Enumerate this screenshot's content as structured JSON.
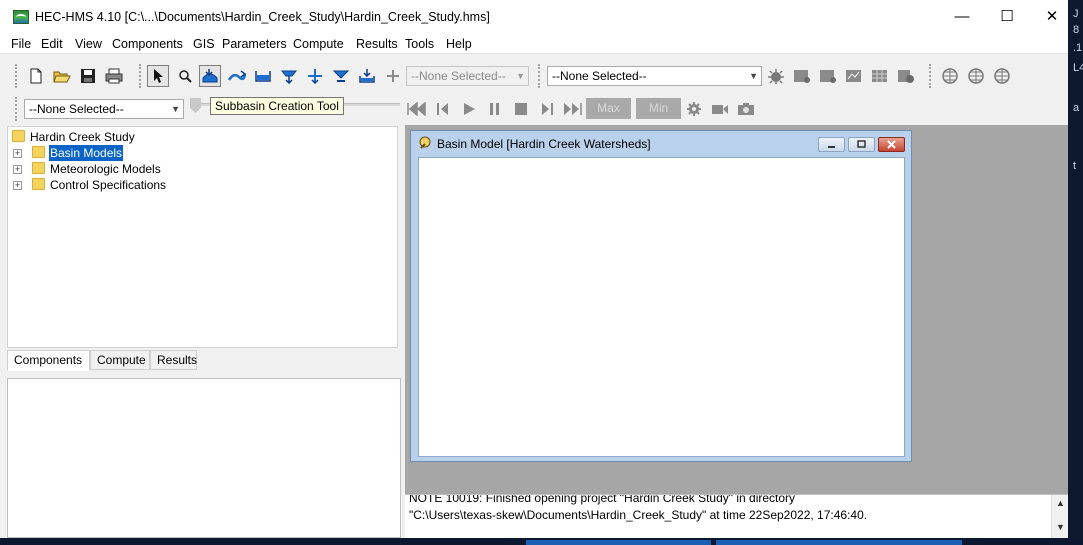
{
  "window": {
    "title": "HEC-HMS 4.10 [C:\\...\\Documents\\Hardin_Creek_Study\\Hardin_Creek_Study.hms]",
    "controls": {
      "minimize": "—",
      "maximize": "☐",
      "close": "✕"
    }
  },
  "menu": [
    "File",
    "Edit",
    "View",
    "Components",
    "GIS",
    "Parameters",
    "Compute",
    "Results",
    "Tools",
    "Help"
  ],
  "toolbar": {
    "combo_run": "--None Selected--",
    "combo_element": "--None Selected--",
    "combo_basin": "--None Selected--",
    "tooltip": "Subbasin Creation Tool",
    "max_label": "Max",
    "min_label": "Min"
  },
  "tree": {
    "root": "Hardin Creek Study",
    "items": [
      {
        "label": "Basin Models",
        "selected": true
      },
      {
        "label": "Meteorologic Models",
        "selected": false
      },
      {
        "label": "Control Specifications",
        "selected": false
      }
    ]
  },
  "tabs": [
    "Components",
    "Compute",
    "Results"
  ],
  "active_tab": "Components",
  "basin_window": {
    "title": "Basin Model [Hardin Creek Watersheds]"
  },
  "log": {
    "lines": [
      "NOTE 10019:  Finished opening project \"Hardin Creek Study\" in directory",
      "\"C:\\Users\\texas-skew\\Documents\\Hardin_Creek_Study\" at time 22Sep2022, 17:46:40."
    ]
  },
  "edge_glyphs": [
    "J",
    "8",
    ".1",
    "L4",
    "a",
    "t"
  ],
  "colors": {
    "selection": "#0a64c8",
    "workspace": "#a6a6a6",
    "inner_window_frame": "#b9d1ea",
    "tooltip_bg": "#ffffe1"
  },
  "icons": [
    "new-file-icon",
    "open-folder-icon",
    "save-icon",
    "print-icon",
    "arrow-select-icon",
    "zoom-icon",
    "subbasin-tool-icon",
    "reach-tool-icon",
    "reservoir-tool-icon",
    "source-tool-icon",
    "junction-tool-icon",
    "diversion-tool-icon",
    "sink-tool-icon",
    "pan-cross-icon",
    "compute-icons",
    "grid-globe-icons",
    "rewind-icon",
    "step-back-icon",
    "play-icon",
    "pause-icon",
    "stop-icon",
    "step-forward-icon",
    "fast-forward-icon",
    "gear-icon",
    "video-camera-icon",
    "camera-icon"
  ]
}
